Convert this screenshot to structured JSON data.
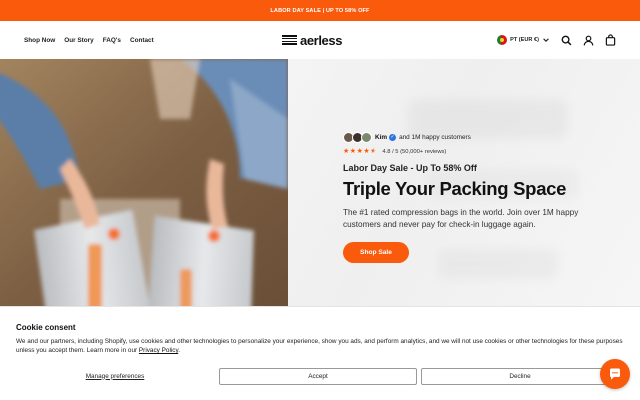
{
  "announcement": {
    "text": "LABOR DAY SALE | UP TO 58% OFF"
  },
  "header": {
    "nav": [
      {
        "label": "Shop Now"
      },
      {
        "label": "Our Story"
      },
      {
        "label": "FAQ's"
      },
      {
        "label": "Contact"
      }
    ],
    "logo_text": "aerless",
    "locale_label": "PT (EUR €)",
    "icons": [
      "search-icon",
      "account-icon",
      "cart-icon",
      "chevron-down-icon"
    ]
  },
  "hero": {
    "reviewer_name": "Kim",
    "reviewer_text": "and 1M happy customers",
    "rating": 4.8,
    "rating_text": "4.8 / 5 (50,000+ reviews)",
    "promo": "Labor Day Sale - Up To 58% Off",
    "headline": "Triple Your Packing Space",
    "subtext": "The #1 rated compression bags in the world. Join over 1M happy customers and never pay for check-in luggage again.",
    "cta_label": "Shop Sale"
  },
  "cookie": {
    "title": "Cookie consent",
    "text": "We and our partners, including Shopify, use cookies and other technologies to personalize your experience, show you ads, and perform analytics, and we will not use cookies or other technologies for these purposes unless you accept them. Learn more in our",
    "policy_link": "Privacy Policy",
    "manage_label": "Manage preferences",
    "accept_label": "Accept",
    "decline_label": "Decline"
  },
  "colors": {
    "accent": "#fa5a0c",
    "text": "#111111",
    "verified": "#2a73e0"
  }
}
